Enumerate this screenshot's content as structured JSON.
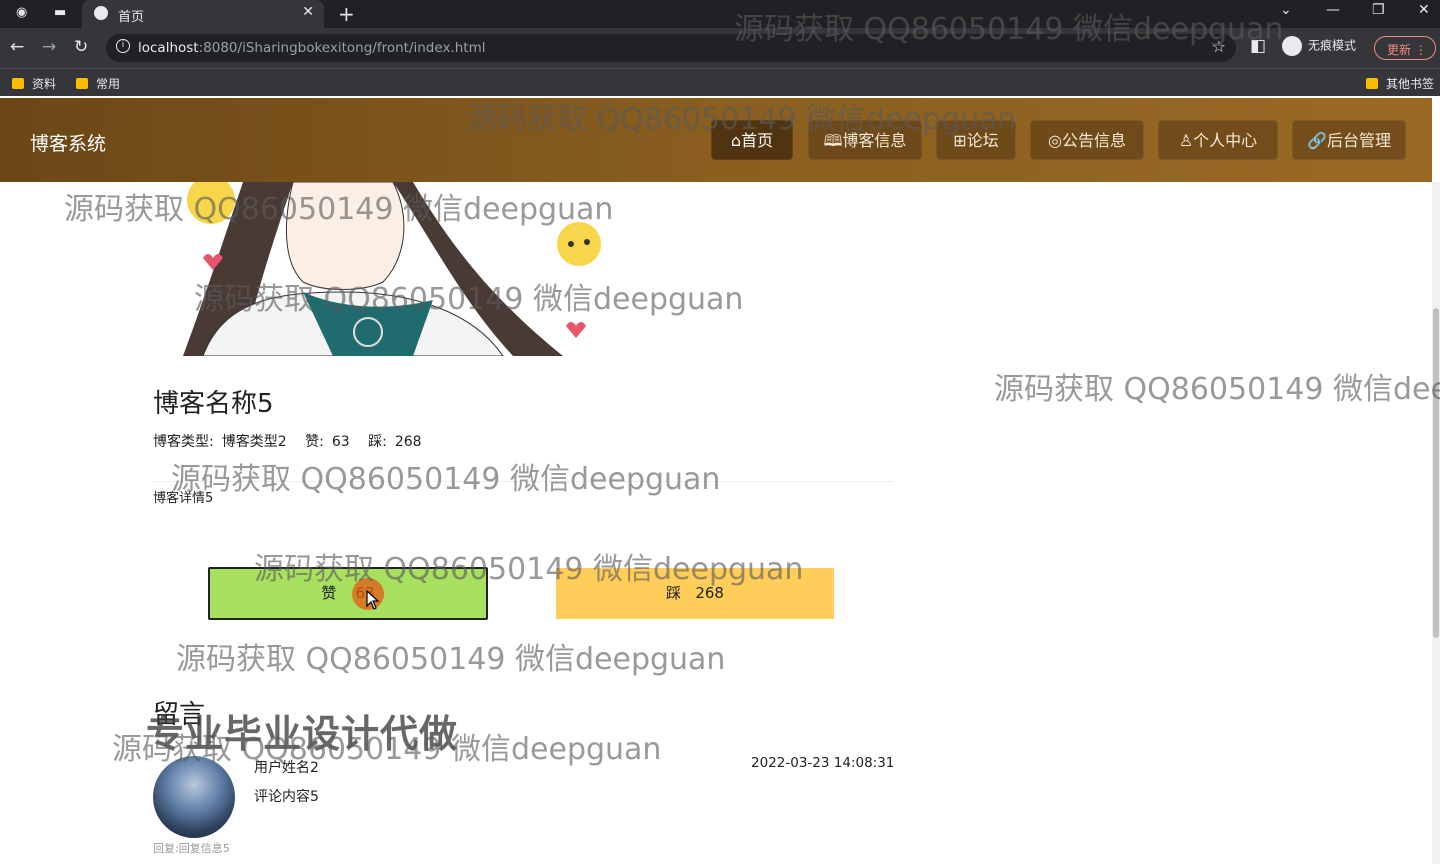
{
  "browser": {
    "tab_title": "首页",
    "url_host": "localhost",
    "url_path": ":8080/iSharingbokexitong/front/index.html",
    "incognito_label": "无痕模式",
    "update_label": "更新",
    "bookmarks": [
      "资料",
      "常用"
    ],
    "other_bookmarks": "其他书签"
  },
  "site": {
    "brand": "博客系统",
    "nav": [
      "⌂首页",
      "🕮博客信息",
      "⊞论坛",
      "◎公告信息",
      "♙个人中心",
      "🔗后台管理"
    ]
  },
  "blog": {
    "name": "博客名称5",
    "type_label": "博客类型:",
    "type_value": "博客类型2",
    "like_label": "赞:",
    "like_value": "63",
    "dislike_label": "踩:",
    "dislike_value": "268",
    "detail": "博客详情5"
  },
  "vote": {
    "like_text": "赞",
    "like_count": "63",
    "dislike_text": "踩",
    "dislike_count": "268"
  },
  "comments": {
    "title": "留言",
    "overlay": "专业毕业设计代做",
    "items": [
      {
        "user": "用户姓名2",
        "content": "评论内容5",
        "date": "2022-03-23 14:08:31",
        "reply": "回复:回复信息5"
      }
    ]
  },
  "watermark": "源码获取 QQ86050149 微信deepguan",
  "watermark_clipped": "源码获取 QQ86050149 微信dee",
  "colors": {
    "header_brown": "#8a5e1f",
    "like_green": "#a8e05f",
    "dislike_yellow": "#ffcd5a"
  }
}
